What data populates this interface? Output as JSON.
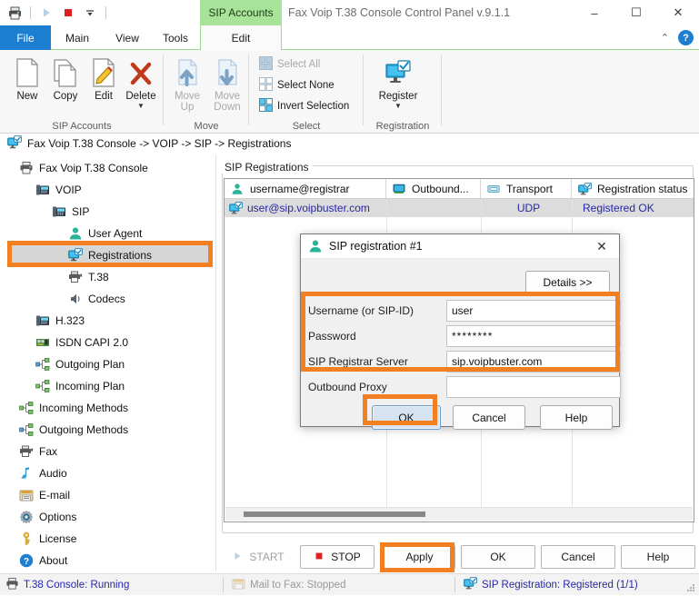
{
  "window": {
    "title": "Fax Voip T.38 Console Control Panel v.9.1.1",
    "contextual_tab_header": "SIP Accounts",
    "minimize": "–",
    "maximize": "☐",
    "close": "✕",
    "collapse_ribbon": "⌃",
    "help": "?"
  },
  "quick_access": {
    "printer_icon": "printer-icon",
    "start_icon": "play-icon",
    "stop_icon": "stop-icon",
    "dropdown_icon": "chevron-down-icon"
  },
  "ribbon_tabs": [
    {
      "label": "File",
      "id": "file"
    },
    {
      "label": "Main",
      "id": "main"
    },
    {
      "label": "View",
      "id": "view"
    },
    {
      "label": "Tools",
      "id": "tools"
    },
    {
      "label": "Edit",
      "id": "edit"
    }
  ],
  "ribbon": {
    "groups": [
      {
        "label": "SIP Accounts"
      },
      {
        "label": "Move"
      },
      {
        "label": "Select"
      },
      {
        "label": "Registration"
      }
    ],
    "sip_accounts": [
      {
        "label": "New",
        "icon": "new-document-icon",
        "disabled": false,
        "caret": false
      },
      {
        "label": "Copy",
        "icon": "copy-icon",
        "disabled": false,
        "caret": false
      },
      {
        "label": "Edit",
        "icon": "edit-pencil-icon",
        "disabled": false,
        "caret": false
      },
      {
        "label": "Delete",
        "icon": "delete-x-icon",
        "disabled": false,
        "caret": true
      }
    ],
    "move": [
      {
        "label": "Move\nUp",
        "line1": "Move",
        "line2": "Up",
        "icon": "move-up-icon",
        "disabled": true
      },
      {
        "label": "Move\nDown",
        "line1": "Move",
        "line2": "Down",
        "icon": "move-down-icon",
        "disabled": true
      }
    ],
    "select": [
      {
        "label": "Select All",
        "icon": "select-all-icon",
        "disabled": true
      },
      {
        "label": "Select None",
        "icon": "select-none-icon",
        "disabled": false
      },
      {
        "label": "Invert Selection",
        "icon": "invert-selection-icon",
        "disabled": false
      }
    ],
    "registration": [
      {
        "label": "Register",
        "icon": "register-monitor-icon",
        "caret": true
      }
    ]
  },
  "breadcrumb": {
    "icon": "monitor-check-icon",
    "text": "Fax Voip T.38 Console -> VOIP -> SIP -> Registrations"
  },
  "tree": [
    {
      "label": "Fax Voip T.38 Console",
      "icon": "printer-icon",
      "indent": 0,
      "selected": false
    },
    {
      "label": "VOIP",
      "icon": "voip-phone-icon",
      "indent": 1,
      "selected": false
    },
    {
      "label": "SIP",
      "icon": "voip-phone-icon",
      "indent": 2,
      "selected": false
    },
    {
      "label": "User Agent",
      "icon": "user-icon",
      "indent": 3,
      "selected": false
    },
    {
      "label": "Registrations",
      "icon": "monitor-check-icon",
      "indent": 3,
      "selected": true
    },
    {
      "label": "T.38",
      "icon": "fax-icon",
      "indent": 3,
      "selected": false
    },
    {
      "label": "Codecs",
      "icon": "speaker-icon",
      "indent": 3,
      "selected": false
    },
    {
      "label": "H.323",
      "icon": "voip-phone-icon",
      "indent": 2,
      "selected": false
    },
    {
      "label": "ISDN CAPI 2.0",
      "icon": "isdn-card-icon",
      "indent": 2,
      "selected": false
    },
    {
      "label": "Outgoing Plan",
      "icon": "plan-icon",
      "indent": 2,
      "selected": false
    },
    {
      "label": "Incoming Plan",
      "icon": "plan-icon",
      "indent": 2,
      "selected": false
    },
    {
      "label": "Incoming Methods",
      "icon": "plan-icon",
      "indent": 1,
      "selected": false
    },
    {
      "label": "Outgoing Methods",
      "icon": "plan-icon",
      "indent": 1,
      "selected": false
    },
    {
      "label": "Fax",
      "icon": "fax-icon",
      "indent": 1,
      "selected": false
    },
    {
      "label": "Audio",
      "icon": "audio-icon",
      "indent": 1,
      "selected": false
    },
    {
      "label": "E-mail",
      "icon": "email-icon",
      "indent": 1,
      "selected": false
    },
    {
      "label": "Options",
      "icon": "gear-icon",
      "indent": 1,
      "selected": false
    },
    {
      "label": "License",
      "icon": "key-icon",
      "indent": 1,
      "selected": false
    },
    {
      "label": "About",
      "icon": "about-info-icon",
      "indent": 1,
      "selected": false
    }
  ],
  "registrations_panel": {
    "group_title": "SIP Registrations",
    "columns": [
      {
        "label": "username@registrar",
        "icon": "user-icon"
      },
      {
        "label": "Outbound...",
        "icon": "monitor-icon"
      },
      {
        "label": "Transport",
        "icon": "transport-icon"
      },
      {
        "label": "Registration status",
        "icon": "monitor-check-icon"
      }
    ],
    "rows": [
      {
        "icon": "monitor-check-icon",
        "username": "user@sip.voipbuster.com",
        "outbound": "",
        "transport": "UDP",
        "status": "Registered OK"
      }
    ]
  },
  "bottom_buttons": [
    {
      "label": "START",
      "icon": "play-icon",
      "disabled": true,
      "flat": true
    },
    {
      "label": "STOP",
      "icon": "stop-icon",
      "disabled": false,
      "flat": false
    },
    {
      "label": "Apply",
      "icon": "",
      "disabled": false,
      "flat": false
    },
    {
      "label": "OK",
      "icon": "",
      "disabled": false,
      "flat": false
    },
    {
      "label": "Cancel",
      "icon": "",
      "disabled": false,
      "flat": false
    },
    {
      "label": "Help",
      "icon": "",
      "disabled": false,
      "flat": false
    }
  ],
  "statusbar": {
    "console": "T.38 Console: Running",
    "mail_to_fax": "Mail to Fax: Stopped",
    "sip_registration": "SIP Registration: Registered (1/1)"
  },
  "dialog": {
    "title": "SIP registration #1",
    "title_icon": "user-icon",
    "close": "✕",
    "details_button": "Details >>",
    "fields": [
      {
        "label": "Username (or SIP-ID)",
        "value": "user",
        "placeholder": ""
      },
      {
        "label": "Password",
        "value": "********",
        "placeholder": ""
      },
      {
        "label": "SIP Registrar Server",
        "value": "sip.voipbuster.com",
        "placeholder": ""
      },
      {
        "label": "Outbound Proxy",
        "value": "",
        "placeholder": ""
      }
    ],
    "buttons": [
      {
        "label": "OK",
        "default": true
      },
      {
        "label": "Cancel",
        "default": false
      },
      {
        "label": "Help",
        "default": false
      }
    ]
  },
  "colors": {
    "highlight_orange": "#f28020",
    "contextual_tab_green": "#a8e39a",
    "file_tab_blue": "#1c7fd1",
    "link_text": "#2727a8",
    "default_button_blue": "#d6e4f2"
  }
}
